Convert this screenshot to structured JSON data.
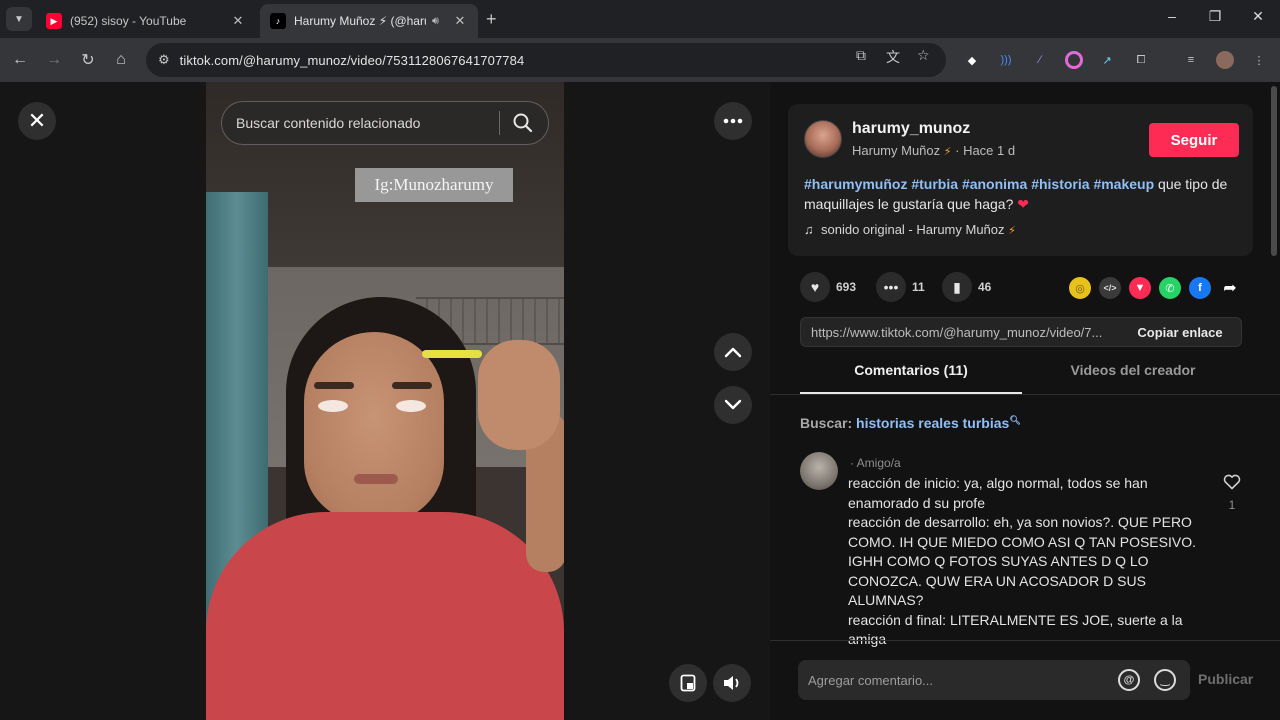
{
  "browser": {
    "tabs": [
      {
        "title": "(952) sisoy - YouTube",
        "favicon": "youtube-icon",
        "close": "✕"
      },
      {
        "title": "Harumy Muñoz ⚡ (@harumy",
        "favicon": "tiktok-icon",
        "close": "✕"
      }
    ],
    "new_tab": "+",
    "window_controls": {
      "minimize": "–",
      "maximize": "❐",
      "close": "✕"
    },
    "url": "tiktok.com/@harumy_munoz/video/7531128067641707784"
  },
  "video": {
    "search_placeholder": "Buscar contenido relacionado",
    "overlay_text": "Ig:Munozharumy"
  },
  "author": {
    "username": "harumy_munoz",
    "nickname": "Harumy Muñoz",
    "time": "· Hace 1 d",
    "follow_label": "Seguir"
  },
  "description": {
    "hashtags": [
      "#harumymuñoz",
      "#turbia",
      "#anonima",
      "#historia",
      "#makeup"
    ],
    "text": " que tipo de maquillajes le gustaría que haga?",
    "heart": "❤"
  },
  "music": {
    "label": "sonido original - Harumy Muñoz"
  },
  "stats": {
    "likes": "693",
    "comments": "11",
    "saves": "46"
  },
  "share_icons": [
    "embed-coin-icon",
    "code-icon",
    "send-icon",
    "whatsapp-icon",
    "facebook-icon",
    "share-arrow-icon"
  ],
  "link": {
    "url": "https://www.tiktok.com/@harumy_munoz/video/7...",
    "copy_label": "Copiar enlace"
  },
  "panel_tabs": {
    "comments": "Comentarios (11)",
    "creator_videos": "Videos del creador"
  },
  "related_search": {
    "prefix": "Buscar:",
    "term": "historias reales turbias"
  },
  "comment": {
    "author": "· Amigo/a",
    "text": "reacción de inicio: ya, algo normal, todos se han enamorado d su profe\nreacción de desarrollo: eh, ya son novios?. QUE PERO COMO. IH QUE MIEDO COMO ASI Q TAN POSESIVO. IGHH COMO Q FOTOS SUYAS ANTES D Q LO CONOZCA. QUW ERA UN ACOSADOR D SUS ALUMNAS?\nreacción d final: LITERALMENTE ES JOE, suerte a la amiga",
    "likes": "1"
  },
  "compose": {
    "placeholder": "Agregar comentario...",
    "publish": "Publicar"
  },
  "colors": {
    "accent": "#fe2c55",
    "hashtag": "#8fbff7",
    "background": "#121212"
  }
}
